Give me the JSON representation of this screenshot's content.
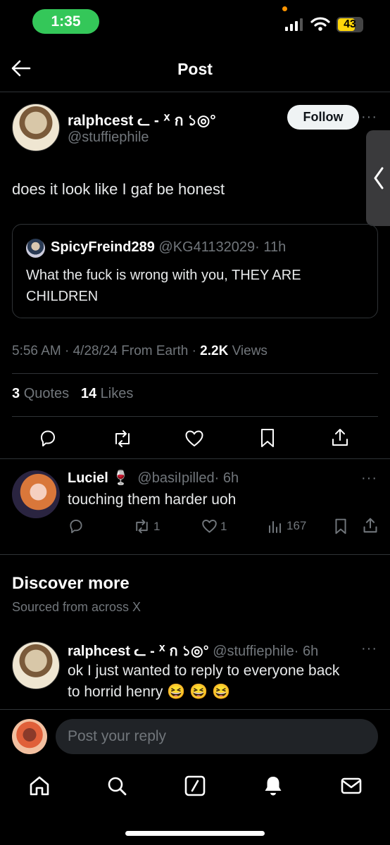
{
  "status_bar": {
    "time": "1:35",
    "battery": "43"
  },
  "header": {
    "title": "Post"
  },
  "post": {
    "display_name": "ralphcest ᓚ - ᕽ ก ১◎°",
    "handle": "@stuffiephile",
    "follow_label": "Follow",
    "text": "does it look like I gaf be honest",
    "quoted": {
      "display_name": "SpicyFreind289",
      "handle": "@KG41132029",
      "time": "· 11h",
      "text_line1": "What the fuck is wrong with you, THEY ARE",
      "text_line2": "CHILDREN"
    },
    "meta": {
      "timestamp": "5:56 AM · 4/28/24 From Earth ·",
      "views_count": "2.2K",
      "views_label": "Views"
    },
    "stats": {
      "quotes_count": "3",
      "quotes_label": "Quotes",
      "likes_count": "14",
      "likes_label": "Likes"
    }
  },
  "reply": {
    "display_name": "Luciel",
    "emoji": "🍷",
    "handle": "@basiIpilled",
    "time": "· 6h",
    "text": "touching them harder uoh",
    "retweets": "1",
    "likes": "1",
    "views": "167"
  },
  "discover": {
    "title": "Discover more",
    "subtitle": "Sourced from across X",
    "post": {
      "display_name": "ralphcest ᓚ - ᕽ ก ১◎°",
      "handle": "@stuffiephile",
      "time": "· 6h",
      "text_line1": "ok I just wanted to reply to everyone back",
      "text_line2": "to horrid henry 😆 😆 😆"
    }
  },
  "composer": {
    "placeholder": "Post your reply"
  },
  "icons": {
    "back": "arrow-left-icon",
    "more": "ellipsis-icon",
    "reply": "comment-icon",
    "retweet": "repost-icon",
    "like": "heart-icon",
    "bookmark": "bookmark-icon",
    "share": "share-icon",
    "views": "bar-chart-icon",
    "home": "home-icon",
    "search": "search-icon",
    "grok": "compose-icon",
    "notifications": "bell-icon",
    "messages": "mail-icon"
  },
  "colors": {
    "background": "#000000",
    "text": "#e7e9ea",
    "muted": "#71767b",
    "status_pill": "#34c759",
    "battery": "#ffd60a"
  }
}
